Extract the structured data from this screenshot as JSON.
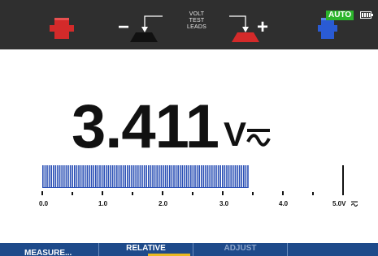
{
  "header": {
    "volt_test_leads_lines": [
      "VOLT",
      "TEST",
      "LEADS"
    ],
    "minus_sign": "−",
    "plus_sign": "+",
    "auto_badge": "AUTO",
    "icons": [
      "red-probe-icon",
      "black-connector-icon",
      "red-connector-icon",
      "blue-probe-icon",
      "battery-icon"
    ],
    "colors": {
      "bar": "#2f2f2f",
      "red_probe": "#d42a2a",
      "blue_probe": "#2a5bd4",
      "auto": "#2cb52c"
    }
  },
  "reading": {
    "value": "3.411",
    "unit": "V",
    "mode_icon": "ac-dc-icon"
  },
  "bargraph": {
    "ticks": [
      "0.0",
      "1.0",
      "2.0",
      "3.0",
      "4.0",
      "5.0V"
    ],
    "range_max": 5.0,
    "fill_value": 3.411,
    "range_icon": "ac-dc-icon",
    "fill_color": "#2a4fb5"
  },
  "softkeys": {
    "f1": "MEASURE...",
    "f2": "RELATIVE",
    "f3": "ADJUST",
    "colors": {
      "background": "#1e4a8a",
      "active_state": "#e8b820"
    }
  }
}
